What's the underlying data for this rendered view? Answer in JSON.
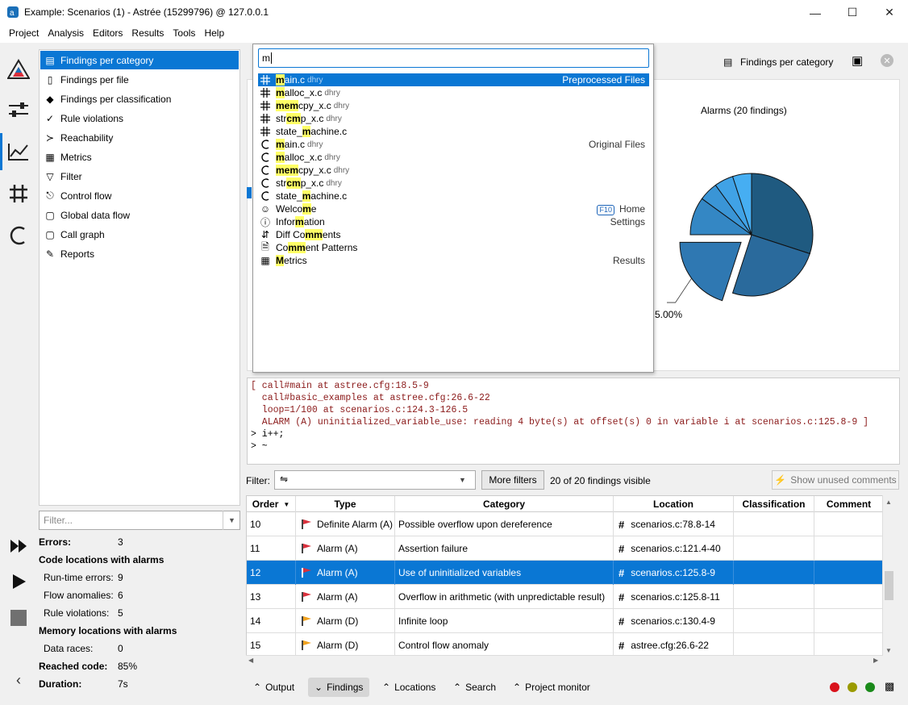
{
  "window": {
    "title": "Example: Scenarios (1) - Astrée (15299796) @ 127.0.0.1"
  },
  "menu": [
    "Project",
    "Analysis",
    "Editors",
    "Results",
    "Tools",
    "Help"
  ],
  "nav": {
    "items": [
      {
        "label": "Findings per category",
        "icon": "table-icon"
      },
      {
        "label": "Findings per file",
        "icon": "file-icon"
      },
      {
        "label": "Findings per classification",
        "icon": "tag-icon"
      },
      {
        "label": "Rule violations",
        "icon": "check-icon"
      },
      {
        "label": "Reachability",
        "icon": "reach-icon"
      },
      {
        "label": "Metrics",
        "icon": "metrics-icon"
      },
      {
        "label": "Filter",
        "icon": "filter-icon"
      },
      {
        "label": "Control flow",
        "icon": "control-flow-icon"
      },
      {
        "label": "Global data flow",
        "icon": "data-flow-icon"
      },
      {
        "label": "Call graph",
        "icon": "call-graph-icon"
      },
      {
        "label": "Reports",
        "icon": "pencil-icon"
      }
    ],
    "filter_placeholder": "Filter..."
  },
  "stats": {
    "errors_label": "Errors:",
    "errors_value": "3",
    "code_locations_label": "Code locations with alarms",
    "runtime_label": "Run-time errors:",
    "runtime_value": "9",
    "flow_label": "Flow anomalies:",
    "flow_value": "6",
    "rule_label": "Rule violations:",
    "rule_value": "5",
    "memory_label": "Memory locations with alarms",
    "races_label": "Data races:",
    "races_value": "0",
    "reached_label": "Reached code:",
    "reached_value": "85%",
    "duration_label": "Duration:",
    "duration_value": "7s"
  },
  "view": {
    "title": "Findings per category",
    "chart_title": "Alarms (20 findings)",
    "pie_label": "5.00%"
  },
  "chart_data": {
    "type": "pie",
    "title": "Alarms (20 findings)",
    "slices": [
      {
        "value": 6,
        "color": "#1f5a80"
      },
      {
        "value": 5,
        "color": "#2a6a9c"
      },
      {
        "value": 4,
        "color": "#2f78b2",
        "exploded": true
      },
      {
        "value": 2,
        "color": "#3487c4"
      },
      {
        "value": 1,
        "color": "#3a95d6"
      },
      {
        "value": 1,
        "color": "#40a2e6"
      },
      {
        "value": 1,
        "color": "#46aef2"
      }
    ],
    "labels": [
      "5.00%"
    ]
  },
  "console": {
    "lines": [
      "[ call#main at astree.cfg:18.5-9",
      "  call#basic_examples at astree.cfg:26.6-22",
      "  loop=1/100 at scenarios.c:124.3-126.5",
      "  ALARM (A) uninitialized_variable_use: reading 4 byte(s) at offset(s) 0 in variable i at scenarios.c:125.8-9 ]",
      "> i++;",
      "> ~"
    ]
  },
  "filterbar": {
    "label": "Filter:",
    "more_filters": "More filters",
    "visible": "20 of 20 findings visible",
    "show_unused": "Show unused comments"
  },
  "table": {
    "headers": [
      "Order",
      "Type",
      "Category",
      "Location",
      "Classification",
      "Comment"
    ],
    "rows": [
      {
        "order": "10",
        "type": "Definite Alarm (A)",
        "flag": "r",
        "category": "Possible overflow upon dereference",
        "location": "scenarios.c:78.8-14"
      },
      {
        "order": "11",
        "type": "Alarm (A)",
        "flag": "r",
        "category": "Assertion failure",
        "location": "scenarios.c:121.4-40"
      },
      {
        "order": "12",
        "type": "Alarm (A)",
        "flag": "r",
        "category": "Use of uninitialized variables",
        "location": "scenarios.c:125.8-9",
        "selected": true
      },
      {
        "order": "13",
        "type": "Alarm (A)",
        "flag": "r",
        "category": "Overflow in arithmetic (with unpredictable result)",
        "location": "scenarios.c:125.8-11"
      },
      {
        "order": "14",
        "type": "Alarm (D)",
        "flag": "o",
        "category": "Infinite loop",
        "location": "scenarios.c:130.4-9"
      },
      {
        "order": "15",
        "type": "Alarm (D)",
        "flag": "o",
        "category": "Control flow anomaly",
        "location": "astree.cfg:26.6-22"
      }
    ]
  },
  "bottom_tabs": [
    "Output",
    "Findings",
    "Locations",
    "Search",
    "Project monitor"
  ],
  "status_dots": [
    "#d9121b",
    "#9a9a00",
    "#1a8a1a"
  ],
  "popup": {
    "query": "m",
    "rows": [
      {
        "icon": "#",
        "pre": "",
        "hl": "m",
        "post": "ain.c",
        "sub": "dhry",
        "group": "Preprocessed Files",
        "selected": true
      },
      {
        "icon": "#",
        "pre": "",
        "hl": "m",
        "post": "alloc_x.c",
        "sub": "dhry",
        "group": ""
      },
      {
        "icon": "#",
        "pre": "",
        "hl": "mem",
        "post": "cpy_x.c",
        "sub": "dhry",
        "group": ""
      },
      {
        "icon": "#",
        "pre": "str",
        "hl": "cm",
        "post": "p_x.c",
        "sub": "dhry",
        "group": ""
      },
      {
        "icon": "#",
        "pre": "state_",
        "hl": "m",
        "post": "achine.c",
        "sub": "",
        "group": ""
      },
      {
        "icon": "C",
        "pre": "",
        "hl": "m",
        "post": "ain.c",
        "sub": "dhry",
        "group": "Original Files"
      },
      {
        "icon": "C",
        "pre": "",
        "hl": "m",
        "post": "alloc_x.c",
        "sub": "dhry",
        "group": ""
      },
      {
        "icon": "C",
        "pre": "",
        "hl": "mem",
        "post": "cpy_x.c",
        "sub": "dhry",
        "group": ""
      },
      {
        "icon": "C",
        "pre": "str",
        "hl": "cm",
        "post": "p_x.c",
        "sub": "dhry",
        "group": ""
      },
      {
        "icon": "C",
        "pre": "state_",
        "hl": "m",
        "post": "achine.c",
        "sub": "",
        "group": ""
      },
      {
        "icon": "person",
        "pre": "Welco",
        "hl": "m",
        "post": "e",
        "sub": "",
        "group": "Home",
        "kbd": "F10"
      },
      {
        "icon": "info",
        "pre": "Infor",
        "hl": "m",
        "post": "ation",
        "sub": "",
        "group": "Settings"
      },
      {
        "icon": "diff",
        "pre": "Diff Co",
        "hl": "mm",
        "post": "ents",
        "sub": "",
        "group": ""
      },
      {
        "icon": "doc",
        "pre": "Co",
        "hl": "mm",
        "post": "ent Patterns",
        "sub": "",
        "group": ""
      },
      {
        "icon": "metrics",
        "pre": "",
        "hl": "M",
        "post": "etrics",
        "sub": "",
        "group": "Results"
      }
    ]
  }
}
